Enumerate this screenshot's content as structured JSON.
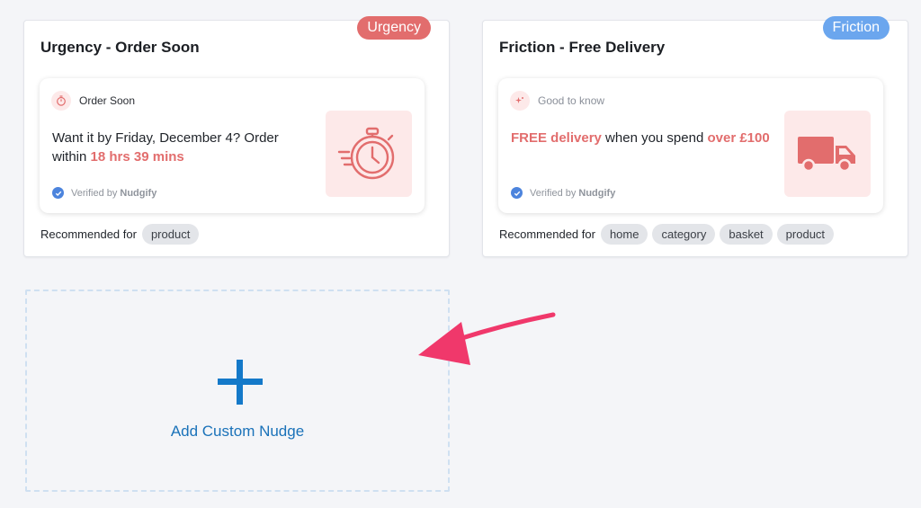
{
  "cards": [
    {
      "badge": "Urgency",
      "title": "Urgency - Order Soon",
      "header_label": "Order Soon",
      "text_before": "Want it by Friday, December 4? Order within ",
      "text_highlight": "18 hrs 39 mins",
      "verified_prefix": "Verified by",
      "verified_brand": "Nudgify",
      "image_icon": "stopwatch-icon",
      "recommended_label": "Recommended for",
      "tags": [
        "product"
      ]
    },
    {
      "badge": "Friction",
      "title": "Friction - Free Delivery",
      "header_label": "Good to know",
      "text_highlight_1": "FREE delivery",
      "text_middle": " when you spend ",
      "text_highlight_2": "over £100",
      "verified_prefix": "Verified by",
      "verified_brand": "Nudgify",
      "image_icon": "delivery-truck-icon",
      "recommended_label": "Recommended for",
      "tags": [
        "home",
        "category",
        "basket",
        "product"
      ]
    }
  ],
  "add_custom": {
    "label": "Add Custom Nudge",
    "icon": "plus-icon"
  },
  "colors": {
    "urgency": "#e26d6d",
    "friction": "#6ba6ee",
    "accent_blue": "#1479c9",
    "arrow": "#f0386b"
  }
}
